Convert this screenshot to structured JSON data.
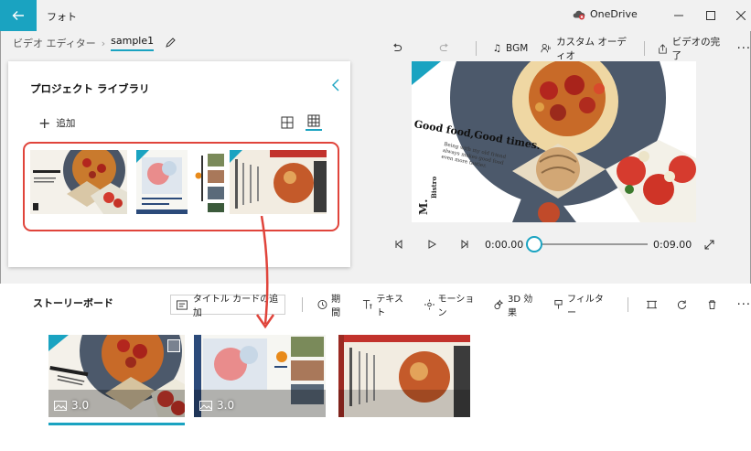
{
  "app": {
    "title": "フォト"
  },
  "onedrive": {
    "label": "OneDrive"
  },
  "breadcrumb": {
    "root": "ビデオ エディター",
    "project": "sample1"
  },
  "toolbar": {
    "bgm": "BGM",
    "custom_audio": "カスタム オーディオ",
    "finish_video": "ビデオの完了",
    "more": "···"
  },
  "library": {
    "title": "プロジェクト ライブラリ",
    "add_label": "追加"
  },
  "preview": {
    "headline": "Good food,Good times.",
    "tagline": "Being with my old friend always makes good food even more tastier.",
    "brand": "Bistro",
    "brand_mark": "M."
  },
  "playback": {
    "current_time": "0:00.00",
    "end_time": "0:09.00",
    "progress": 0.0
  },
  "storyboard": {
    "title": "ストーリーボード",
    "add_title_card": "タイトル カードの追加",
    "duration": "期間",
    "text": "テキスト",
    "motion": "モーション",
    "effects_3d": "3D 効果",
    "filter": "フィルター",
    "more": "···"
  },
  "clips": [
    {
      "duration": "3.0",
      "selected": true
    },
    {
      "duration": "3.0",
      "selected": false
    },
    {
      "duration": "",
      "selected": false
    }
  ],
  "colors": {
    "accent": "#1aa3c1",
    "highlight": "#e0443b"
  }
}
